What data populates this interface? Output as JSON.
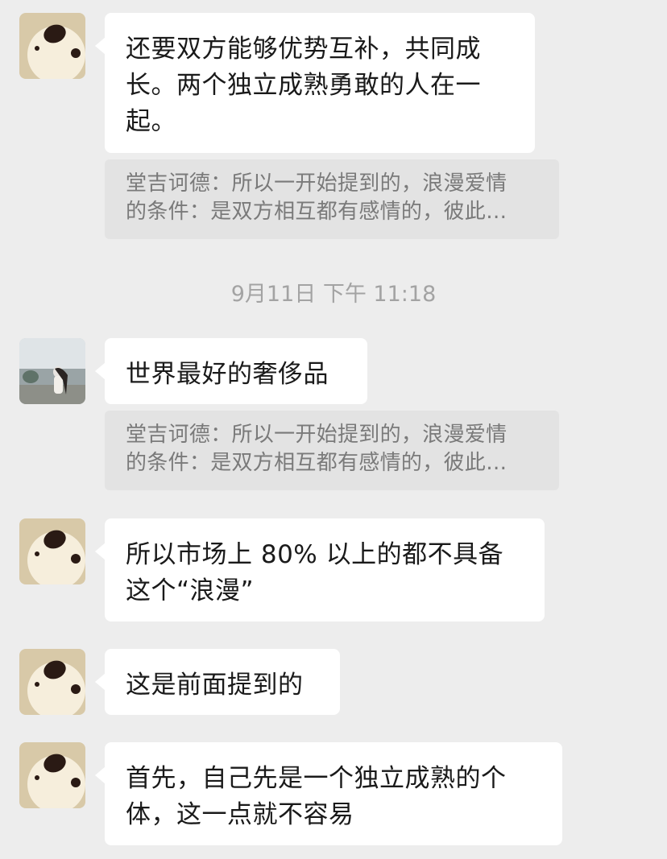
{
  "messages": [
    {
      "text": "还要双方能够优势互补，共同成长。两个独立成熟勇敢的人在一起。"
    },
    {
      "quote_line1": "堂吉诃德：所以一开始提到的，浪漫爱情",
      "quote_line2": "的条件：是双方相互都有感情的，彼此…"
    },
    {
      "timestamp": "9月11日 下午 11:18"
    },
    {
      "text": "世界最好的奢侈品"
    },
    {
      "quote_line1": "堂吉诃德：所以一开始提到的，浪漫爱情",
      "quote_line2": "的条件：是双方相互都有感情的，彼此…"
    },
    {
      "text": "所以市场上 80% 以上的都不具备这个“浪漫”"
    },
    {
      "text": "这是前面提到的"
    },
    {
      "text": "首先，自己先是一个独立成熟的个体，这一点就不容易"
    }
  ]
}
